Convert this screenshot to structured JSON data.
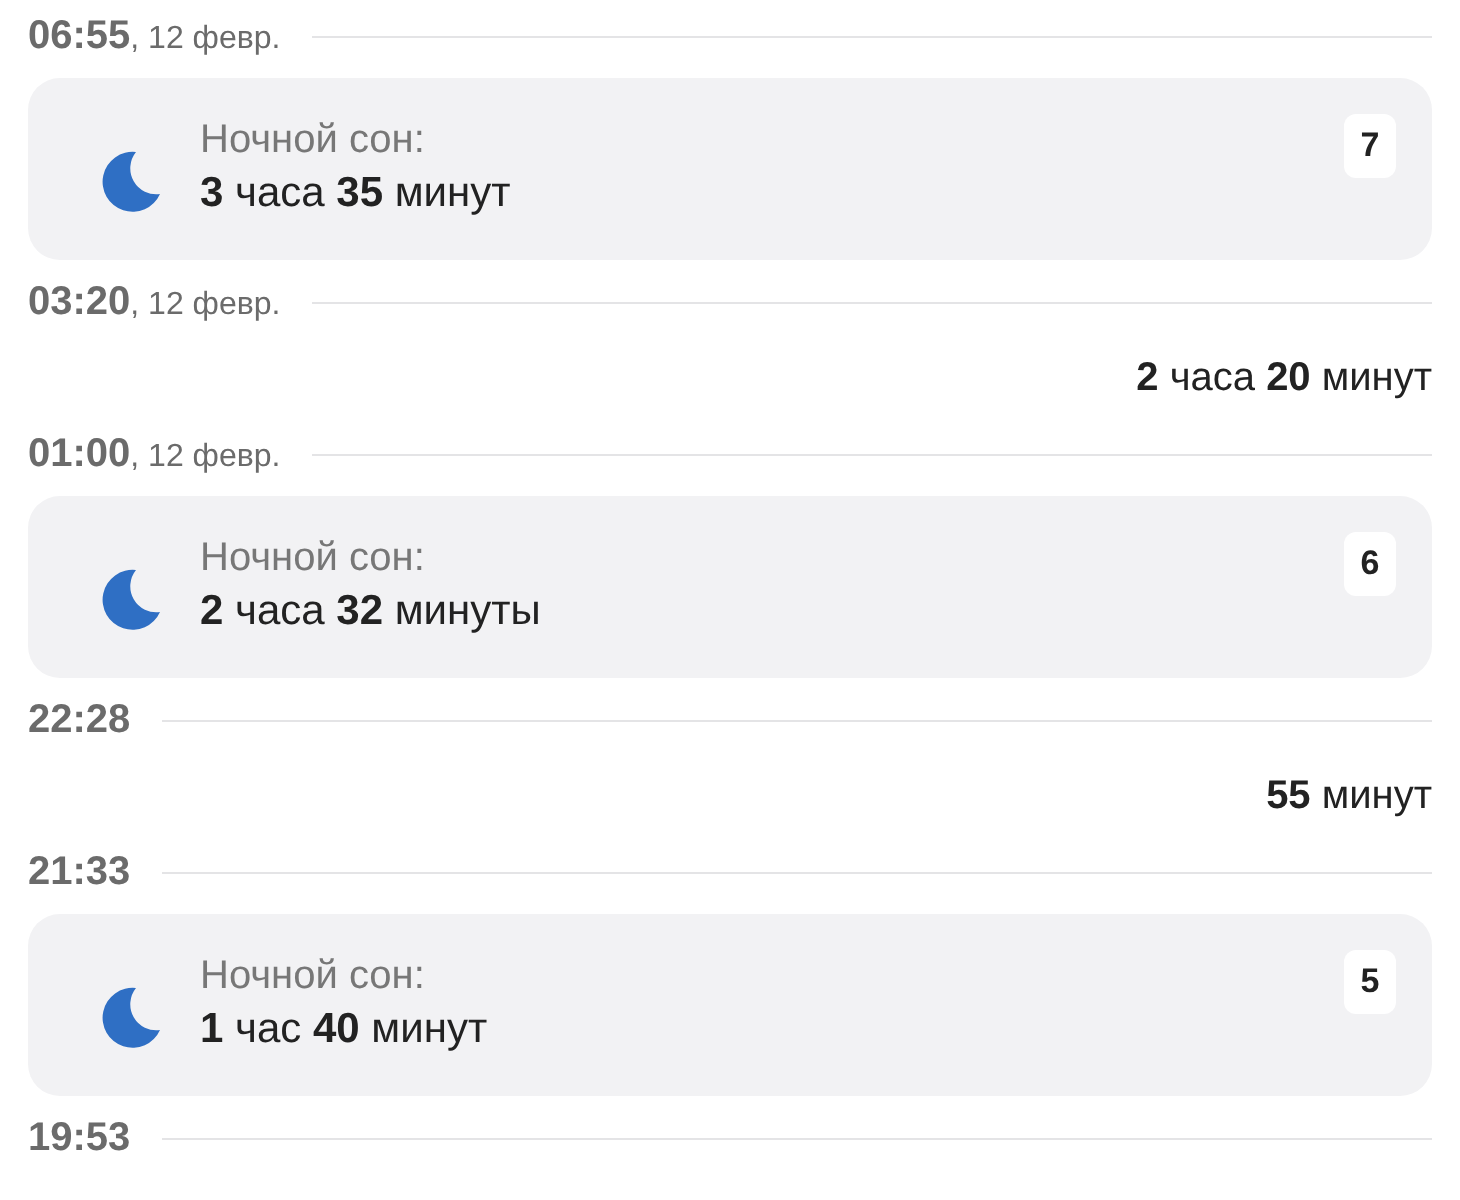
{
  "entries": [
    {
      "kind": "time",
      "time": "06:55",
      "date": ", 12 февр."
    },
    {
      "kind": "sleep",
      "label": "Ночной сон:",
      "duration": "**3** часа **35** минут",
      "badge": "7"
    },
    {
      "kind": "time",
      "time": "03:20",
      "date": ", 12 февр."
    },
    {
      "kind": "gap",
      "duration": "**2** часа **20** минут"
    },
    {
      "kind": "time",
      "time": "01:00",
      "date": ", 12 февр."
    },
    {
      "kind": "sleep",
      "label": "Ночной сон:",
      "duration": "**2** часа **32** минуты",
      "badge": "6"
    },
    {
      "kind": "time",
      "time": "22:28"
    },
    {
      "kind": "gap",
      "duration": "**55** минут"
    },
    {
      "kind": "time",
      "time": "21:33"
    },
    {
      "kind": "sleep",
      "label": "Ночной сон:",
      "duration": "**1** час **40** минут",
      "badge": "5"
    },
    {
      "kind": "time",
      "time": "19:53"
    }
  ]
}
